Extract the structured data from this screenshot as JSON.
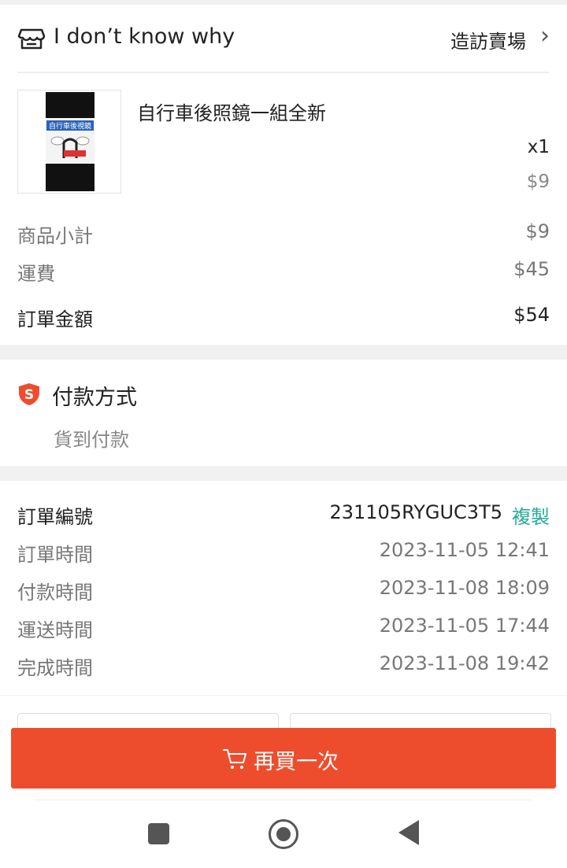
{
  "shop": {
    "name": "I don’t know why",
    "visit_label": "造訪賣場",
    "chevron": "›"
  },
  "product": {
    "title": "自行車後照鏡一組全新",
    "quantity": "x1",
    "price": "$9",
    "thumbnail_text": "自行車後視鏡"
  },
  "summary": {
    "subtotal_label": "商品小計",
    "subtotal_value": "$9",
    "shipping_label": "運費",
    "shipping_value": "$45",
    "total_label": "訂單金額",
    "total_value": "$54"
  },
  "payment": {
    "title": "付款方式",
    "method": "貨到付款",
    "icon_color": "#ee4d2d"
  },
  "order": {
    "number_label": "訂單編號",
    "number_value": "231105RYGUC3T5",
    "copy_label": "複製",
    "copy_color": "#26aa99",
    "times": [
      {
        "label": "訂單時間",
        "value": "2023-11-05 12:41"
      },
      {
        "label": "付款時間",
        "value": "2023-11-08 18:09"
      },
      {
        "label": "運送時間",
        "value": "2023-11-05 17:44"
      },
      {
        "label": "完成時間",
        "value": "2023-11-08 19:42"
      }
    ]
  },
  "cta": {
    "label": "再買一次",
    "color": "#ee4d2d"
  },
  "navbar": {
    "items": [
      "recent-apps-icon",
      "home-icon",
      "back-icon"
    ]
  }
}
